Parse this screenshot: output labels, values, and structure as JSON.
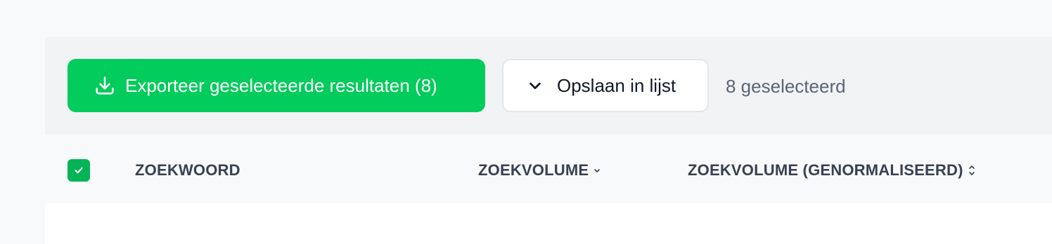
{
  "toolbar": {
    "export_label": "Exporteer geselecteerde resultaten (8)",
    "export_icon": "download-icon",
    "save_label": "Opslaan in lijst",
    "save_icon": "chevron-down-icon",
    "selected_text": "8 geselecteerd"
  },
  "table": {
    "select_all_checked": true,
    "columns": [
      {
        "label": "ZOEKWOORD",
        "sort": "none"
      },
      {
        "label": "ZOEKVOLUME",
        "sort": "descending"
      },
      {
        "label": "ZOEKVOLUME (GENORMALISEERD)",
        "sort": "sortable"
      }
    ]
  },
  "colors": {
    "accent_green": "#02cc5c",
    "checkbox_green": "#02b455",
    "toolbar_bg": "#f2f3f5",
    "header_text": "#374151"
  }
}
